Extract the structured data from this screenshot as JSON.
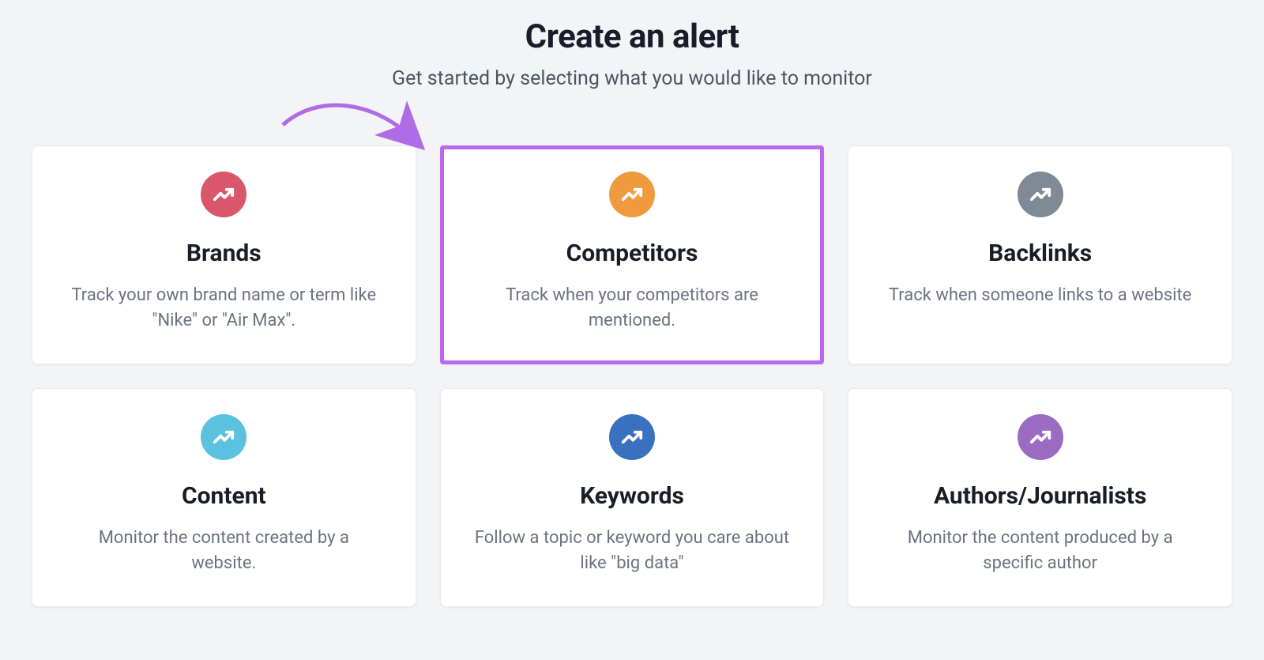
{
  "page_title": "Create an alert",
  "page_subtitle": "Get started by selecting what you would like to monitor",
  "annotation": {
    "arrow_color": "#b06be6",
    "highlight_color": "#ba68f0",
    "highlighted_card_index": 1
  },
  "cards": [
    {
      "id": "brands",
      "title": "Brands",
      "description": "Track your own brand name or term like \"Nike\" or \"Air Max\".",
      "icon": "trend-arrow-icon",
      "icon_bg": "#d9576b"
    },
    {
      "id": "competitors",
      "title": "Competitors",
      "description": "Track when your competitors are mentioned.",
      "icon": "trend-arrow-icon",
      "icon_bg": "#f09a3e"
    },
    {
      "id": "backlinks",
      "title": "Backlinks",
      "description": "Track when someone links to a website",
      "icon": "trend-arrow-icon",
      "icon_bg": "#7f8a95"
    },
    {
      "id": "content",
      "title": "Content",
      "description": "Monitor the content created by a website.",
      "icon": "trend-arrow-icon",
      "icon_bg": "#5ac1df"
    },
    {
      "id": "keywords",
      "title": "Keywords",
      "description": "Follow a topic or keyword you care about like \"big data\"",
      "icon": "trend-arrow-icon",
      "icon_bg": "#3a70c0"
    },
    {
      "id": "authors",
      "title": "Authors/Journalists",
      "description": "Monitor the content produced by a specific author",
      "icon": "trend-arrow-icon",
      "icon_bg": "#9b6bc2"
    }
  ]
}
